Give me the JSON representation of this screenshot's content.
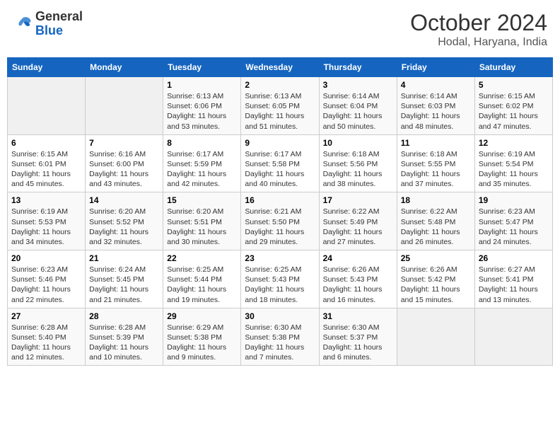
{
  "header": {
    "logo_general": "General",
    "logo_blue": "Blue",
    "month": "October 2024",
    "location": "Hodal, Haryana, India"
  },
  "days_of_week": [
    "Sunday",
    "Monday",
    "Tuesday",
    "Wednesday",
    "Thursday",
    "Friday",
    "Saturday"
  ],
  "weeks": [
    [
      {
        "day": "",
        "info": ""
      },
      {
        "day": "",
        "info": ""
      },
      {
        "day": "1",
        "info": "Sunrise: 6:13 AM\nSunset: 6:06 PM\nDaylight: 11 hours and 53 minutes."
      },
      {
        "day": "2",
        "info": "Sunrise: 6:13 AM\nSunset: 6:05 PM\nDaylight: 11 hours and 51 minutes."
      },
      {
        "day": "3",
        "info": "Sunrise: 6:14 AM\nSunset: 6:04 PM\nDaylight: 11 hours and 50 minutes."
      },
      {
        "day": "4",
        "info": "Sunrise: 6:14 AM\nSunset: 6:03 PM\nDaylight: 11 hours and 48 minutes."
      },
      {
        "day": "5",
        "info": "Sunrise: 6:15 AM\nSunset: 6:02 PM\nDaylight: 11 hours and 47 minutes."
      }
    ],
    [
      {
        "day": "6",
        "info": "Sunrise: 6:15 AM\nSunset: 6:01 PM\nDaylight: 11 hours and 45 minutes."
      },
      {
        "day": "7",
        "info": "Sunrise: 6:16 AM\nSunset: 6:00 PM\nDaylight: 11 hours and 43 minutes."
      },
      {
        "day": "8",
        "info": "Sunrise: 6:17 AM\nSunset: 5:59 PM\nDaylight: 11 hours and 42 minutes."
      },
      {
        "day": "9",
        "info": "Sunrise: 6:17 AM\nSunset: 5:58 PM\nDaylight: 11 hours and 40 minutes."
      },
      {
        "day": "10",
        "info": "Sunrise: 6:18 AM\nSunset: 5:56 PM\nDaylight: 11 hours and 38 minutes."
      },
      {
        "day": "11",
        "info": "Sunrise: 6:18 AM\nSunset: 5:55 PM\nDaylight: 11 hours and 37 minutes."
      },
      {
        "day": "12",
        "info": "Sunrise: 6:19 AM\nSunset: 5:54 PM\nDaylight: 11 hours and 35 minutes."
      }
    ],
    [
      {
        "day": "13",
        "info": "Sunrise: 6:19 AM\nSunset: 5:53 PM\nDaylight: 11 hours and 34 minutes."
      },
      {
        "day": "14",
        "info": "Sunrise: 6:20 AM\nSunset: 5:52 PM\nDaylight: 11 hours and 32 minutes."
      },
      {
        "day": "15",
        "info": "Sunrise: 6:20 AM\nSunset: 5:51 PM\nDaylight: 11 hours and 30 minutes."
      },
      {
        "day": "16",
        "info": "Sunrise: 6:21 AM\nSunset: 5:50 PM\nDaylight: 11 hours and 29 minutes."
      },
      {
        "day": "17",
        "info": "Sunrise: 6:22 AM\nSunset: 5:49 PM\nDaylight: 11 hours and 27 minutes."
      },
      {
        "day": "18",
        "info": "Sunrise: 6:22 AM\nSunset: 5:48 PM\nDaylight: 11 hours and 26 minutes."
      },
      {
        "day": "19",
        "info": "Sunrise: 6:23 AM\nSunset: 5:47 PM\nDaylight: 11 hours and 24 minutes."
      }
    ],
    [
      {
        "day": "20",
        "info": "Sunrise: 6:23 AM\nSunset: 5:46 PM\nDaylight: 11 hours and 22 minutes."
      },
      {
        "day": "21",
        "info": "Sunrise: 6:24 AM\nSunset: 5:45 PM\nDaylight: 11 hours and 21 minutes."
      },
      {
        "day": "22",
        "info": "Sunrise: 6:25 AM\nSunset: 5:44 PM\nDaylight: 11 hours and 19 minutes."
      },
      {
        "day": "23",
        "info": "Sunrise: 6:25 AM\nSunset: 5:43 PM\nDaylight: 11 hours and 18 minutes."
      },
      {
        "day": "24",
        "info": "Sunrise: 6:26 AM\nSunset: 5:43 PM\nDaylight: 11 hours and 16 minutes."
      },
      {
        "day": "25",
        "info": "Sunrise: 6:26 AM\nSunset: 5:42 PM\nDaylight: 11 hours and 15 minutes."
      },
      {
        "day": "26",
        "info": "Sunrise: 6:27 AM\nSunset: 5:41 PM\nDaylight: 11 hours and 13 minutes."
      }
    ],
    [
      {
        "day": "27",
        "info": "Sunrise: 6:28 AM\nSunset: 5:40 PM\nDaylight: 11 hours and 12 minutes."
      },
      {
        "day": "28",
        "info": "Sunrise: 6:28 AM\nSunset: 5:39 PM\nDaylight: 11 hours and 10 minutes."
      },
      {
        "day": "29",
        "info": "Sunrise: 6:29 AM\nSunset: 5:38 PM\nDaylight: 11 hours and 9 minutes."
      },
      {
        "day": "30",
        "info": "Sunrise: 6:30 AM\nSunset: 5:38 PM\nDaylight: 11 hours and 7 minutes."
      },
      {
        "day": "31",
        "info": "Sunrise: 6:30 AM\nSunset: 5:37 PM\nDaylight: 11 hours and 6 minutes."
      },
      {
        "day": "",
        "info": ""
      },
      {
        "day": "",
        "info": ""
      }
    ]
  ]
}
